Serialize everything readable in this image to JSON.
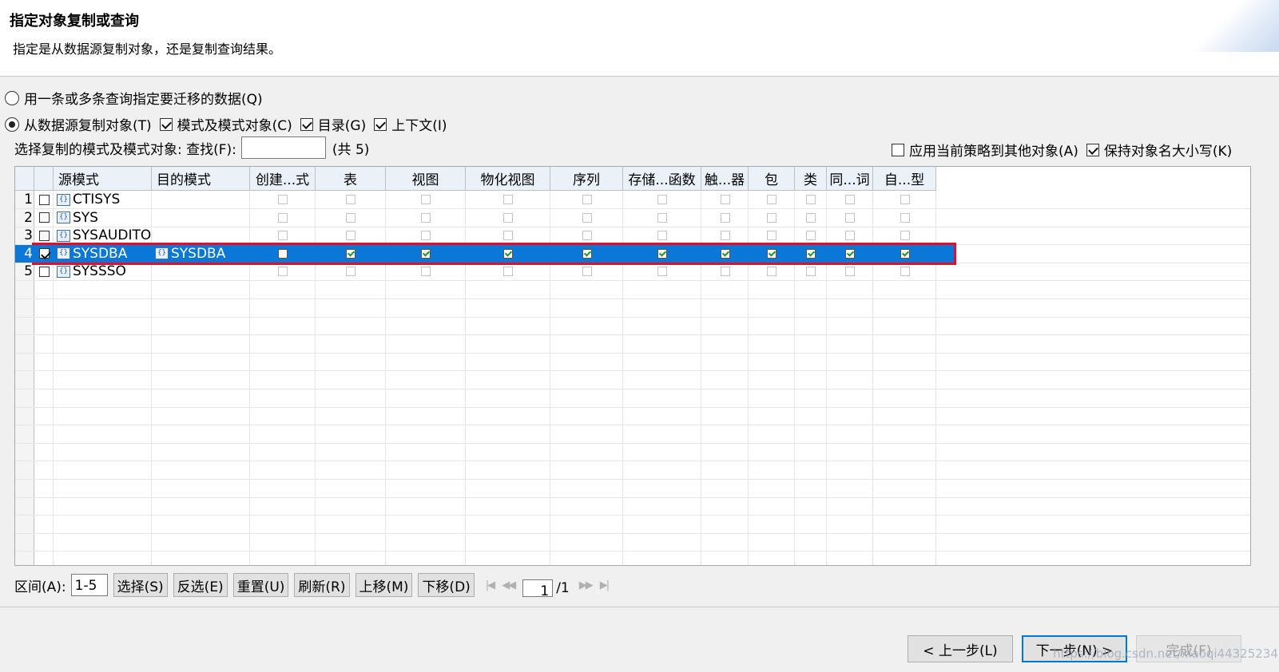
{
  "header": {
    "title": "指定对象复制或查询",
    "subtitle": "指定是从数据源复制对象，还是复制查询结果。"
  },
  "options": {
    "query_radio": {
      "label": "用一条或多条查询指定要迁移的数据(Q)",
      "selected": false
    },
    "copy_radio": {
      "label": "从数据源复制对象(T)",
      "selected": true
    },
    "schema_objects": {
      "label": "模式及模式对象(C)",
      "checked": true
    },
    "catalog": {
      "label": "目录(G)",
      "checked": true
    },
    "context": {
      "label": "上下文(I)",
      "checked": true
    }
  },
  "filter": {
    "label": "选择复制的模式及模式对象: 查找(F):",
    "value": "",
    "count": "(共 5)",
    "apply_policy": {
      "label": "应用当前策略到其他对象(A)",
      "checked": false
    },
    "keep_case": {
      "label": "保持对象名大小写(K)",
      "checked": true
    }
  },
  "table": {
    "columns": [
      "源模式",
      "目的模式",
      "创建...式",
      "表",
      "视图",
      "物化视图",
      "序列",
      "存储...函数",
      "触...器",
      "包",
      "类",
      "同...词",
      "自...型"
    ],
    "rows": [
      {
        "num": "1",
        "selected": false,
        "source": "CTISYS",
        "target": "",
        "checks": [
          false,
          false,
          false,
          false,
          false,
          false,
          false,
          false,
          false,
          false,
          false
        ]
      },
      {
        "num": "2",
        "selected": false,
        "source": "SYS",
        "target": "",
        "checks": [
          false,
          false,
          false,
          false,
          false,
          false,
          false,
          false,
          false,
          false,
          false
        ]
      },
      {
        "num": "3",
        "selected": false,
        "source": "SYSAUDITO",
        "target": "",
        "checks": [
          false,
          false,
          false,
          false,
          false,
          false,
          false,
          false,
          false,
          false,
          false
        ]
      },
      {
        "num": "4",
        "selected": true,
        "source": "SYSDBA",
        "target": "SYSDBA",
        "checks": [
          false,
          true,
          true,
          true,
          true,
          true,
          true,
          true,
          true,
          true,
          true
        ]
      },
      {
        "num": "5",
        "selected": false,
        "source": "SYSSSO",
        "target": "",
        "checks": [
          false,
          false,
          false,
          false,
          false,
          false,
          false,
          false,
          false,
          false,
          false
        ]
      }
    ],
    "schema_icon": "schema-icon"
  },
  "bottom": {
    "range_label": "区间(A):",
    "range_value": "1-5",
    "buttons": [
      "选择(S)",
      "反选(E)",
      "重置(U)",
      "刷新(R)",
      "上移(M)",
      "下移(D)"
    ],
    "page": "1",
    "total": "/1"
  },
  "nav": {
    "back": "< 上一步(L)",
    "next": "下一步(N) >",
    "finish": "完成(F)"
  },
  "watermark": "https://blog.csdn.net/xiaoqi44325234"
}
